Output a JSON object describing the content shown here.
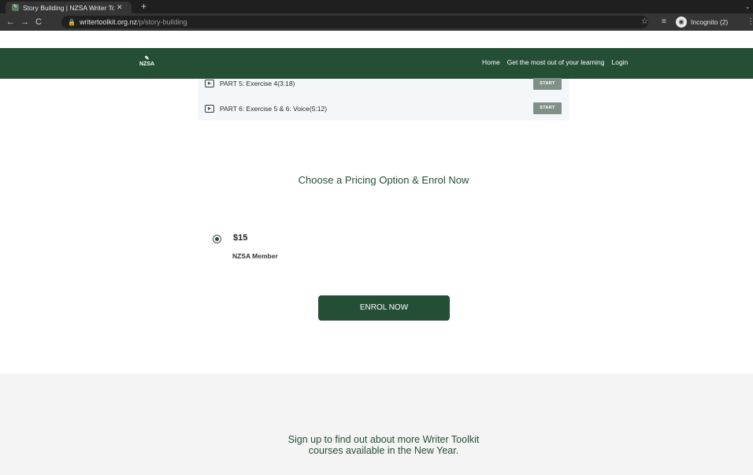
{
  "browser": {
    "tab_title": "Story Building | NZSA Writer To",
    "tab_close": "✕",
    "new_tab": "+",
    "url_domain": "writertoolkit.org.nz",
    "url_path": "/p/story-building",
    "profile_label": "Incognito (2)"
  },
  "site": {
    "logo": "NZSA",
    "nav": [
      "Home",
      "Get the most out of your learning",
      "Login"
    ]
  },
  "lessons": [
    {
      "label": "PART 5: Exercise 4(3:18)",
      "button": "START"
    },
    {
      "label": "PART 6: Exercise 5 & 6: Voice(5:12)",
      "button": "START"
    }
  ],
  "pricing": {
    "heading": "Choose a Pricing Option & Enrol Now",
    "price": "$15",
    "option_name": "NZSA Member",
    "enrol_label": "ENROL NOW"
  },
  "footer": {
    "line1": "Sign up to find out about more Writer Toolkit",
    "line2": "courses available in the New Year."
  },
  "colors": {
    "brand_green": "#244f35",
    "start_button": "#7f9186"
  }
}
